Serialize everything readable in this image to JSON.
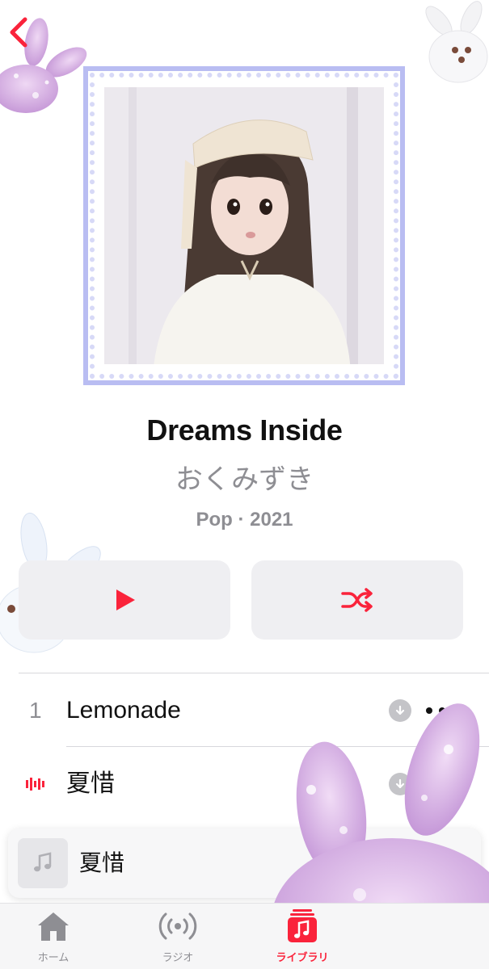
{
  "colors": {
    "accent": "#fa233b",
    "secondary_text": "#8e8e93",
    "button_bg": "#efeff2",
    "frame": "#b9bdf2"
  },
  "nav": {
    "back_icon": "chevron-left-icon"
  },
  "album": {
    "title": "Dreams Inside",
    "artist": "おくみずき",
    "meta": "Pop · 2021"
  },
  "actions": {
    "play_icon": "play-icon",
    "shuffle_icon": "shuffle-icon"
  },
  "tracks": [
    {
      "number": "1",
      "name": "Lemonade",
      "playing": false
    },
    {
      "number": "",
      "name": "夏惜",
      "playing": true
    }
  ],
  "now_playing": {
    "title": "夏惜",
    "artwork_icon": "music-note-icon"
  },
  "tabs": [
    {
      "label": "ホーム",
      "icon": "home-icon",
      "active": false
    },
    {
      "label": "ラジオ",
      "icon": "radio-icon",
      "active": false
    },
    {
      "label": "ライブラリ",
      "icon": "library-icon",
      "active": true
    }
  ]
}
